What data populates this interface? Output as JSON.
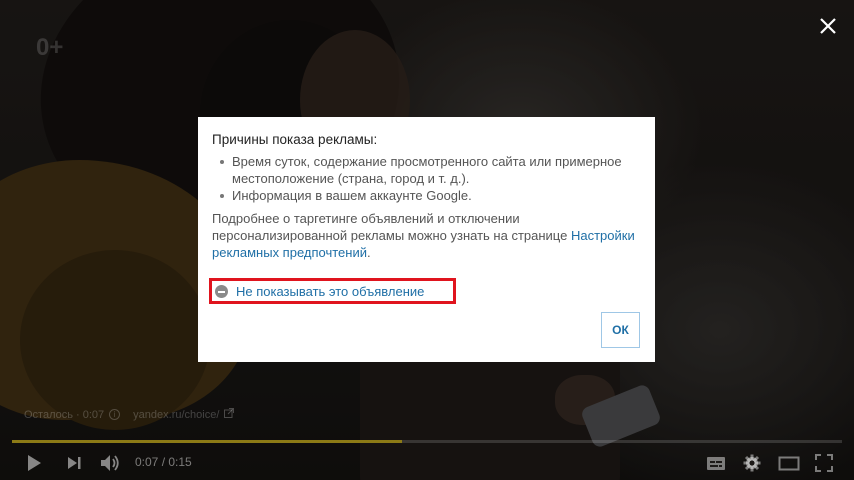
{
  "player": {
    "age_rating": "0+",
    "ad_remaining": "Осталось · 0:07",
    "ad_link": "yandex.ru/choice/",
    "time": "0:07 / 0:15",
    "progress": 0.47,
    "progress_color": "#8c7a16"
  },
  "dialog": {
    "title": "Причины показа рекламы:",
    "reasons": [
      "Время суток, содержание просмотренного сайта или примерное местоположение (страна, город и т. д.).",
      "Информация в вашем аккаунте Google."
    ],
    "more_text": "Подробнее о таргетинге объявлений и отключении персонализированной рекламы можно узнать на странице",
    "settings_link": "Настройки рекламных предпочтений",
    "settings_link_suffix": ".",
    "hide_ad_label": "Не показывать это объявление",
    "ok_label": "ОК",
    "highlight_color": "#e0141e",
    "link_color": "#1f6fa6"
  },
  "icons": {
    "close": "close-icon",
    "play": "play-icon",
    "next": "next-icon",
    "volume": "volume-icon",
    "subtitles": "subtitles-icon",
    "settings": "gear-icon",
    "theater": "theater-icon",
    "fullscreen": "fullscreen-icon"
  }
}
